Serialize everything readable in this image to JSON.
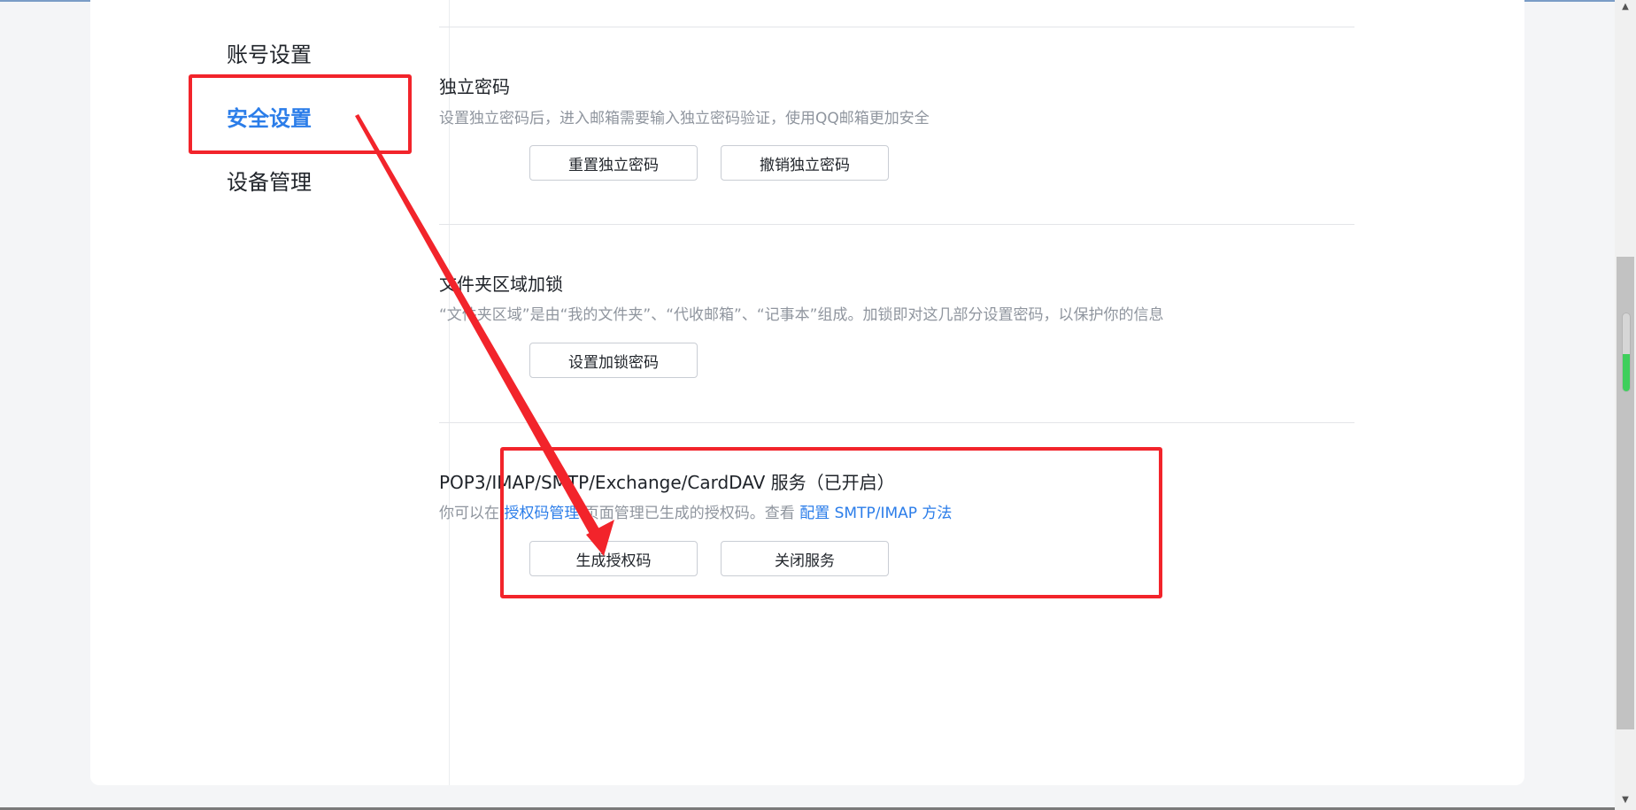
{
  "sidebar": {
    "items": [
      {
        "label": "账号设置"
      },
      {
        "label": "安全设置"
      },
      {
        "label": "设备管理"
      }
    ]
  },
  "sections": {
    "password": {
      "title": "独立密码",
      "desc": "设置独立密码后，进入邮箱需要输入独立密码验证，使用QQ邮箱更加安全",
      "btn_reset": "重置独立密码",
      "btn_revoke": "撤销独立密码"
    },
    "folder_lock": {
      "title": "文件夹区域加锁",
      "desc": "“文件夹区域”是由“我的文件夹”、“代收邮箱”、“记事本”组成。加锁即对这几部分设置密码，以保护你的信息",
      "btn_set": "设置加锁密码"
    },
    "service": {
      "title": "POP3/IMAP/SMTP/Exchange/CardDAV 服务（已开启）",
      "desc_prefix": "你可以在 ",
      "link_auth": "授权码管理",
      "desc_middle": " 页面管理已生成的授权码。查看 ",
      "link_config": "配置 SMTP/IMAP 方法",
      "btn_generate": "生成授权码",
      "btn_close": "关闭服务"
    }
  },
  "colors": {
    "accent": "#2b7de9",
    "annotation": "#f2242b"
  }
}
